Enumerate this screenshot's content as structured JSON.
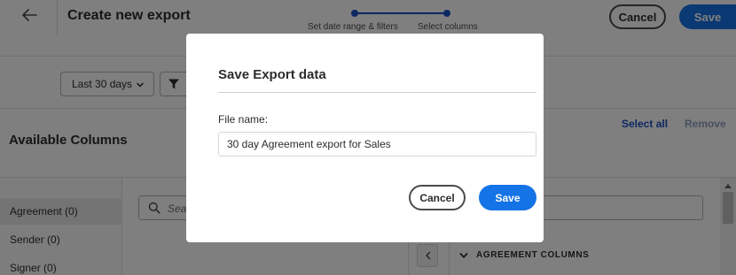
{
  "header": {
    "title": "Create new export",
    "steps": [
      {
        "label": "Set date range & filters"
      },
      {
        "label": "Select columns"
      }
    ],
    "cancel_label": "Cancel",
    "save_label": "Save"
  },
  "filters": {
    "date_range": "Last 30 days"
  },
  "columns_panel": {
    "title": "Available Columns",
    "select_all_label": "Select all",
    "remove_label": "Remove",
    "search_placeholder": "Search",
    "nav_items": [
      {
        "label": "Agreement (0)"
      },
      {
        "label": "Sender (0)"
      },
      {
        "label": "Signer (0)"
      }
    ],
    "group_header": "AGREEMENT COLUMNS"
  },
  "modal": {
    "title": "Save Export data",
    "field_label": "File name:",
    "file_name_value": "30 day Agreement export for Sales",
    "cancel_label": "Cancel",
    "save_label": "Save"
  },
  "colors": {
    "accent": "#1473e6",
    "stepper": "#1a4fc4",
    "link": "#1a4fc4"
  }
}
